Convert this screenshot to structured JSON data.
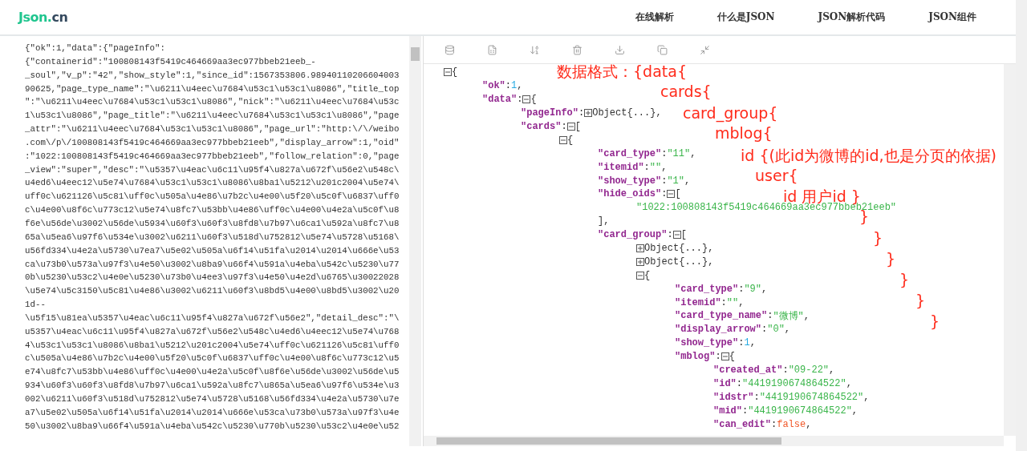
{
  "logo": {
    "text": "Json.",
    "suffix": "cn"
  },
  "nav": [
    "在线解析",
    "什么是JSON",
    "JSON解析代码",
    "JSON组件"
  ],
  "input_lines": [
    "{\"ok\":1,\"data\":{\"pageInfo\":",
    "{\"containerid\":\"100808143f5419c464669aa3ec977bbeb21eeb_-",
    "_soul\",\"v_p\":\"42\",\"show_style\":1,\"since_id\":1567353806.98940110206604003",
    "90625,\"page_type_name\":\"\\u6211\\u4eec\\u7684\\u53c1\\u53c1\\u8086\",\"title_top",
    "\":\"\\u6211\\u4eec\\u7684\\u53c1\\u53c1\\u8086\",\"nick\":\"\\u6211\\u4eec\\u7684\\u53c",
    "1\\u53c1\\u8086\",\"page_title\":\"\\u6211\\u4eec\\u7684\\u53c1\\u53c1\\u8086\",\"page",
    "_attr\":\"\\u6211\\u4eec\\u7684\\u53c1\\u53c1\\u8086\",\"page_url\":\"http:\\/\\/weibo",
    ".com\\/p\\/100808143f5419c464669aa3ec977bbeb21eeb\",\"display_arrow\":1,\"oid\"",
    ":\"1022:100808143f5419c464669aa3ec977bbeb21eeb\",\"follow_relation\":0,\"page",
    "_view\":\"super\",\"desc\":\"\\u5357\\u4eac\\u6c11\\u95f4\\u827a\\u672f\\u56e2\\u548c\\",
    "u4ed6\\u4eec12\\u5e74\\u7684\\u53c1\\u53c1\\u8086\\u8ba1\\u5212\\u201c2004\\u5e74\\",
    "uff0c\\u621126\\u5c81\\uff0c\\u505a\\u4e86\\u7b2c\\u4e00\\u5f20\\u5c0f\\u6837\\uff0",
    "c\\u4e00\\u8f6c\\u773c12\\u5e74\\u8fc7\\u53bb\\u4e86\\uff0c\\u4e00\\u4e2a\\u5c0f\\u8",
    "f6e\\u56de\\u3002\\u56de\\u5934\\u60f3\\u60f3\\u8fd8\\u7b97\\u6ca1\\u592a\\u8fc7\\u8",
    "65a\\u5ea6\\u97f6\\u534e\\u3002\\u6211\\u60f3\\u518d\\u752812\\u5e74\\u5728\\u5168\\",
    "u56fd334\\u4e2a\\u5730\\u7ea7\\u5e02\\u505a\\u6f14\\u51fa\\u2014\\u2014\\u666e\\u53",
    "ca\\u73b0\\u573a\\u97f3\\u4e50\\u3002\\u8ba9\\u66f4\\u591a\\u4eba\\u542c\\u5230\\u77",
    "0b\\u5230\\u53c2\\u4e0e\\u5230\\u73b0\\u4ee3\\u97f3\\u4e50\\u4e2d\\u6765\\u30022028",
    "\\u5e74\\u5c3150\\u5c81\\u4e86\\u3002\\u6211\\u60f3\\u8bd5\\u4e00\\u8bd5\\u3002\\u20",
    "1d--",
    "\\u5f15\\u81ea\\u5357\\u4eac\\u6c11\\u95f4\\u827a\\u672f\\u56e2\",\"detail_desc\":\"\\",
    "u5357\\u4eac\\u6c11\\u95f4\\u827a\\u672f\\u56e2\\u548c\\u4ed6\\u4eec12\\u5e74\\u768",
    "4\\u53c1\\u53c1\\u8086\\u8ba1\\u5212\\u201c2004\\u5e74\\uff0c\\u621126\\u5c81\\uff0",
    "c\\u505a\\u4e86\\u7b2c\\u4e00\\u5f20\\u5c0f\\u6837\\uff0c\\u4e00\\u8f6c\\u773c12\\u5",
    "e74\\u8fc7\\u53bb\\u4e86\\uff0c\\u4e00\\u4e2a\\u5c0f\\u8f6e\\u56de\\u3002\\u56de\\u5",
    "934\\u60f3\\u60f3\\u8fd8\\u7b97\\u6ca1\\u592a\\u8fc7\\u865a\\u5ea6\\u97f6\\u534e\\u3",
    "002\\u6211\\u60f3\\u518d\\u752812\\u5e74\\u5728\\u5168\\u56fd334\\u4e2a\\u5730\\u7e",
    "a7\\u5e02\\u505a\\u6f14\\u51fa\\u2014\\u2014\\u666e\\u53ca\\u73b0\\u573a\\u97f3\\u4e",
    "50\\u3002\\u8ba9\\u66f4\\u591a\\u4eba\\u542c\\u5230\\u770b\\u5230\\u53c2\\u4e0e\\u52"
  ],
  "toolbar": [
    {
      "kind": "database"
    },
    {
      "kind": "excel"
    },
    {
      "kind": "sort"
    },
    {
      "kind": "delete"
    },
    {
      "kind": "download"
    },
    {
      "kind": "copy"
    },
    {
      "kind": "collapse"
    }
  ],
  "tree": {
    "expanded": true,
    "open": "{",
    "children": [
      {
        "key": "\"ok\"",
        "sep": ":",
        "value": "1",
        "kind": "number",
        "after": ","
      },
      {
        "key": "\"data\"",
        "sep": ":",
        "expanded": true,
        "open": "{",
        "children": [
          {
            "key": "\"pageInfo\"",
            "sep": ":",
            "expanded": false,
            "value": "Object{...}",
            "after": ","
          },
          {
            "key": "\"cards\"",
            "sep": ":",
            "expanded": true,
            "open": "[",
            "children": [
              {
                "expanded": true,
                "open": "{",
                "children": [
                  {
                    "key": "\"card_type\"",
                    "sep": ":",
                    "value": "\"11\"",
                    "kind": "string",
                    "after": ","
                  },
                  {
                    "key": "\"itemid\"",
                    "sep": ":",
                    "value": "\"\"",
                    "kind": "string",
                    "after": ","
                  },
                  {
                    "key": "\"show_type\"",
                    "sep": ":",
                    "value": "\"1\"",
                    "kind": "string",
                    "after": ","
                  },
                  {
                    "key": "\"hide_oids\"",
                    "sep": ":",
                    "expanded": true,
                    "open": "[",
                    "close": "],",
                    "children": [
                      {
                        "value": "\"1022:100808143f5419c464669aa3ec977bbeb21eeb\"",
                        "kind": "string"
                      }
                    ]
                  },
                  {
                    "key": "\"card_group\"",
                    "sep": ":",
                    "expanded": true,
                    "open": "[",
                    "children": [
                      {
                        "expanded": false,
                        "value": "Object{...}",
                        "after": ","
                      },
                      {
                        "expanded": false,
                        "value": "Object{...}",
                        "after": ","
                      },
                      {
                        "expanded": true,
                        "open": "{",
                        "children": [
                          {
                            "key": "\"card_type\"",
                            "sep": ":",
                            "value": "\"9\"",
                            "kind": "string",
                            "after": ","
                          },
                          {
                            "key": "\"itemid\"",
                            "sep": ":",
                            "value": "\"\"",
                            "kind": "string",
                            "after": ","
                          },
                          {
                            "key": "\"card_type_name\"",
                            "sep": ":",
                            "value": "\"微博\"",
                            "kind": "string",
                            "after": ","
                          },
                          {
                            "key": "\"display_arrow\"",
                            "sep": ":",
                            "value": "\"0\"",
                            "kind": "string",
                            "after": ","
                          },
                          {
                            "key": "\"show_type\"",
                            "sep": ":",
                            "value": "1",
                            "kind": "number",
                            "after": ","
                          },
                          {
                            "key": "\"mblog\"",
                            "sep": ":",
                            "expanded": true,
                            "open": "{",
                            "children": [
                              {
                                "key": "\"created_at\"",
                                "sep": ":",
                                "value": "\"09-22\"",
                                "kind": "string",
                                "after": ","
                              },
                              {
                                "key": "\"id\"",
                                "sep": ":",
                                "value": "\"4419190674864522\"",
                                "kind": "string",
                                "after": ","
                              },
                              {
                                "key": "\"idstr\"",
                                "sep": ":",
                                "value": "\"4419190674864522\"",
                                "kind": "string",
                                "after": ","
                              },
                              {
                                "key": "\"mid\"",
                                "sep": ":",
                                "value": "\"4419190674864522\"",
                                "kind": "string",
                                "after": ","
                              },
                              {
                                "key": "\"can_edit\"",
                                "sep": ":",
                                "value": "false",
                                "kind": "boolean",
                                "after": ","
                              }
                            ]
                          }
                        ]
                      }
                    ]
                  }
                ]
              }
            ]
          }
        ]
      }
    ]
  },
  "annotations": [
    "数据格式：{data{",
    "cards{",
    "card_group{",
    "mblog{",
    "id {(此id为微博的id,也是分页的依据)",
    "user{",
    "id 用户id }",
    "}",
    "}",
    "}",
    "}",
    "}",
    "}"
  ]
}
